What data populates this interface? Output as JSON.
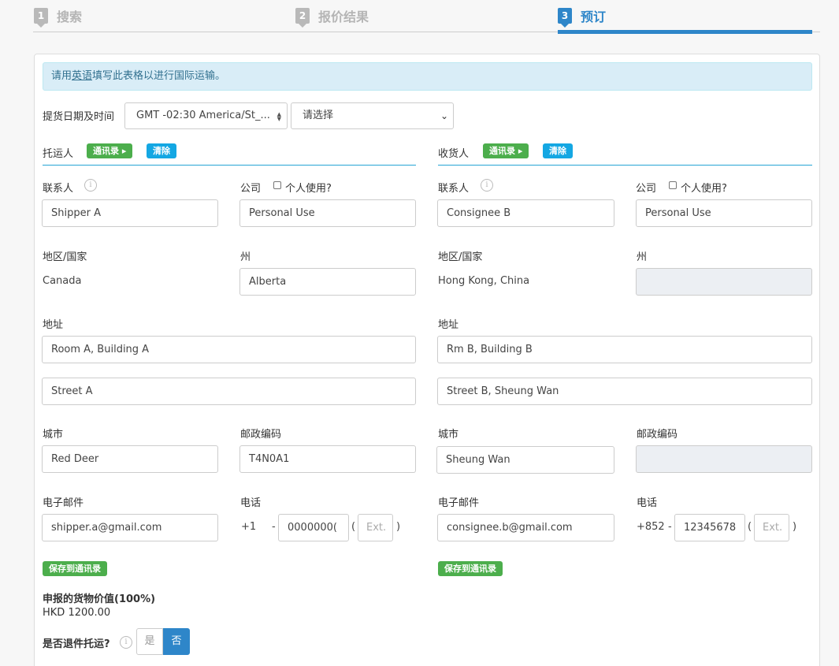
{
  "steps": [
    {
      "num": "1",
      "label": "搜索"
    },
    {
      "num": "2",
      "label": "报价结果"
    },
    {
      "num": "3",
      "label": "预订"
    }
  ],
  "notice": {
    "prefix": "请用",
    "link": "英语",
    "suffix": "填写此表格以进行国际运输。"
  },
  "pickup": {
    "label": "提货日期及时间",
    "timezone": "GMT -02:30 America/St_...",
    "time_placeholder": "请选择"
  },
  "shipper": {
    "title": "托运人",
    "address_book": "通讯录",
    "clear": "清除",
    "contact_label": "联系人",
    "contact": "Shipper A",
    "company_label": "公司",
    "personal_label": "个人使用?",
    "company": "Personal Use",
    "country_label": "地区/国家",
    "country": "Canada",
    "state_label": "州",
    "state": "Alberta",
    "address_label": "地址",
    "address1": "Room A, Building A",
    "address2": "Street A",
    "city_label": "城市",
    "city": "Red Deer",
    "postal_label": "邮政编码",
    "postal": "T4N0A1",
    "email_label": "电子邮件",
    "email": "shipper.a@gmail.com",
    "phone_label": "电话",
    "phone_code": "+1",
    "dash": "-",
    "phone": "0000000(",
    "paren_open": "(",
    "ext_placeholder": "Ext.",
    "paren_close": ")",
    "save": "保存到通讯录"
  },
  "consignee": {
    "title": "收货人",
    "address_book": "通讯录",
    "clear": "清除",
    "contact_label": "联系人",
    "contact": "Consignee B",
    "company_label": "公司",
    "personal_label": "个人使用?",
    "company": "Personal Use",
    "country_label": "地区/国家",
    "country": "Hong Kong, China",
    "state_label": "州",
    "address_label": "地址",
    "address1": "Rm B, Building B",
    "address2": "Street B, Sheung Wan",
    "city_label": "城市",
    "city": "Sheung Wan",
    "postal_label": "邮政编码",
    "email_label": "电子邮件",
    "email": "consignee.b@gmail.com",
    "phone_label": "电话",
    "phone_code": "+852",
    "dash": "-",
    "phone": "12345678",
    "paren_open": "(",
    "ext_placeholder": "Ext.",
    "paren_close": ")",
    "save": "保存到通讯录"
  },
  "declared": {
    "label": "申报的货物价值(100%)",
    "value": "HKD 1200.00"
  },
  "return_shipment": {
    "label": "是否退件托运?",
    "yes": "是",
    "no": "否"
  },
  "icons": {
    "info": "info-icon",
    "caret": "caret-right-icon",
    "checkbox": "checkbox-icon"
  },
  "colors": {
    "primary": "#2e86c9",
    "green": "#4cae4c",
    "blue": "#14a7e3",
    "notice_bg": "#d9edf7"
  }
}
